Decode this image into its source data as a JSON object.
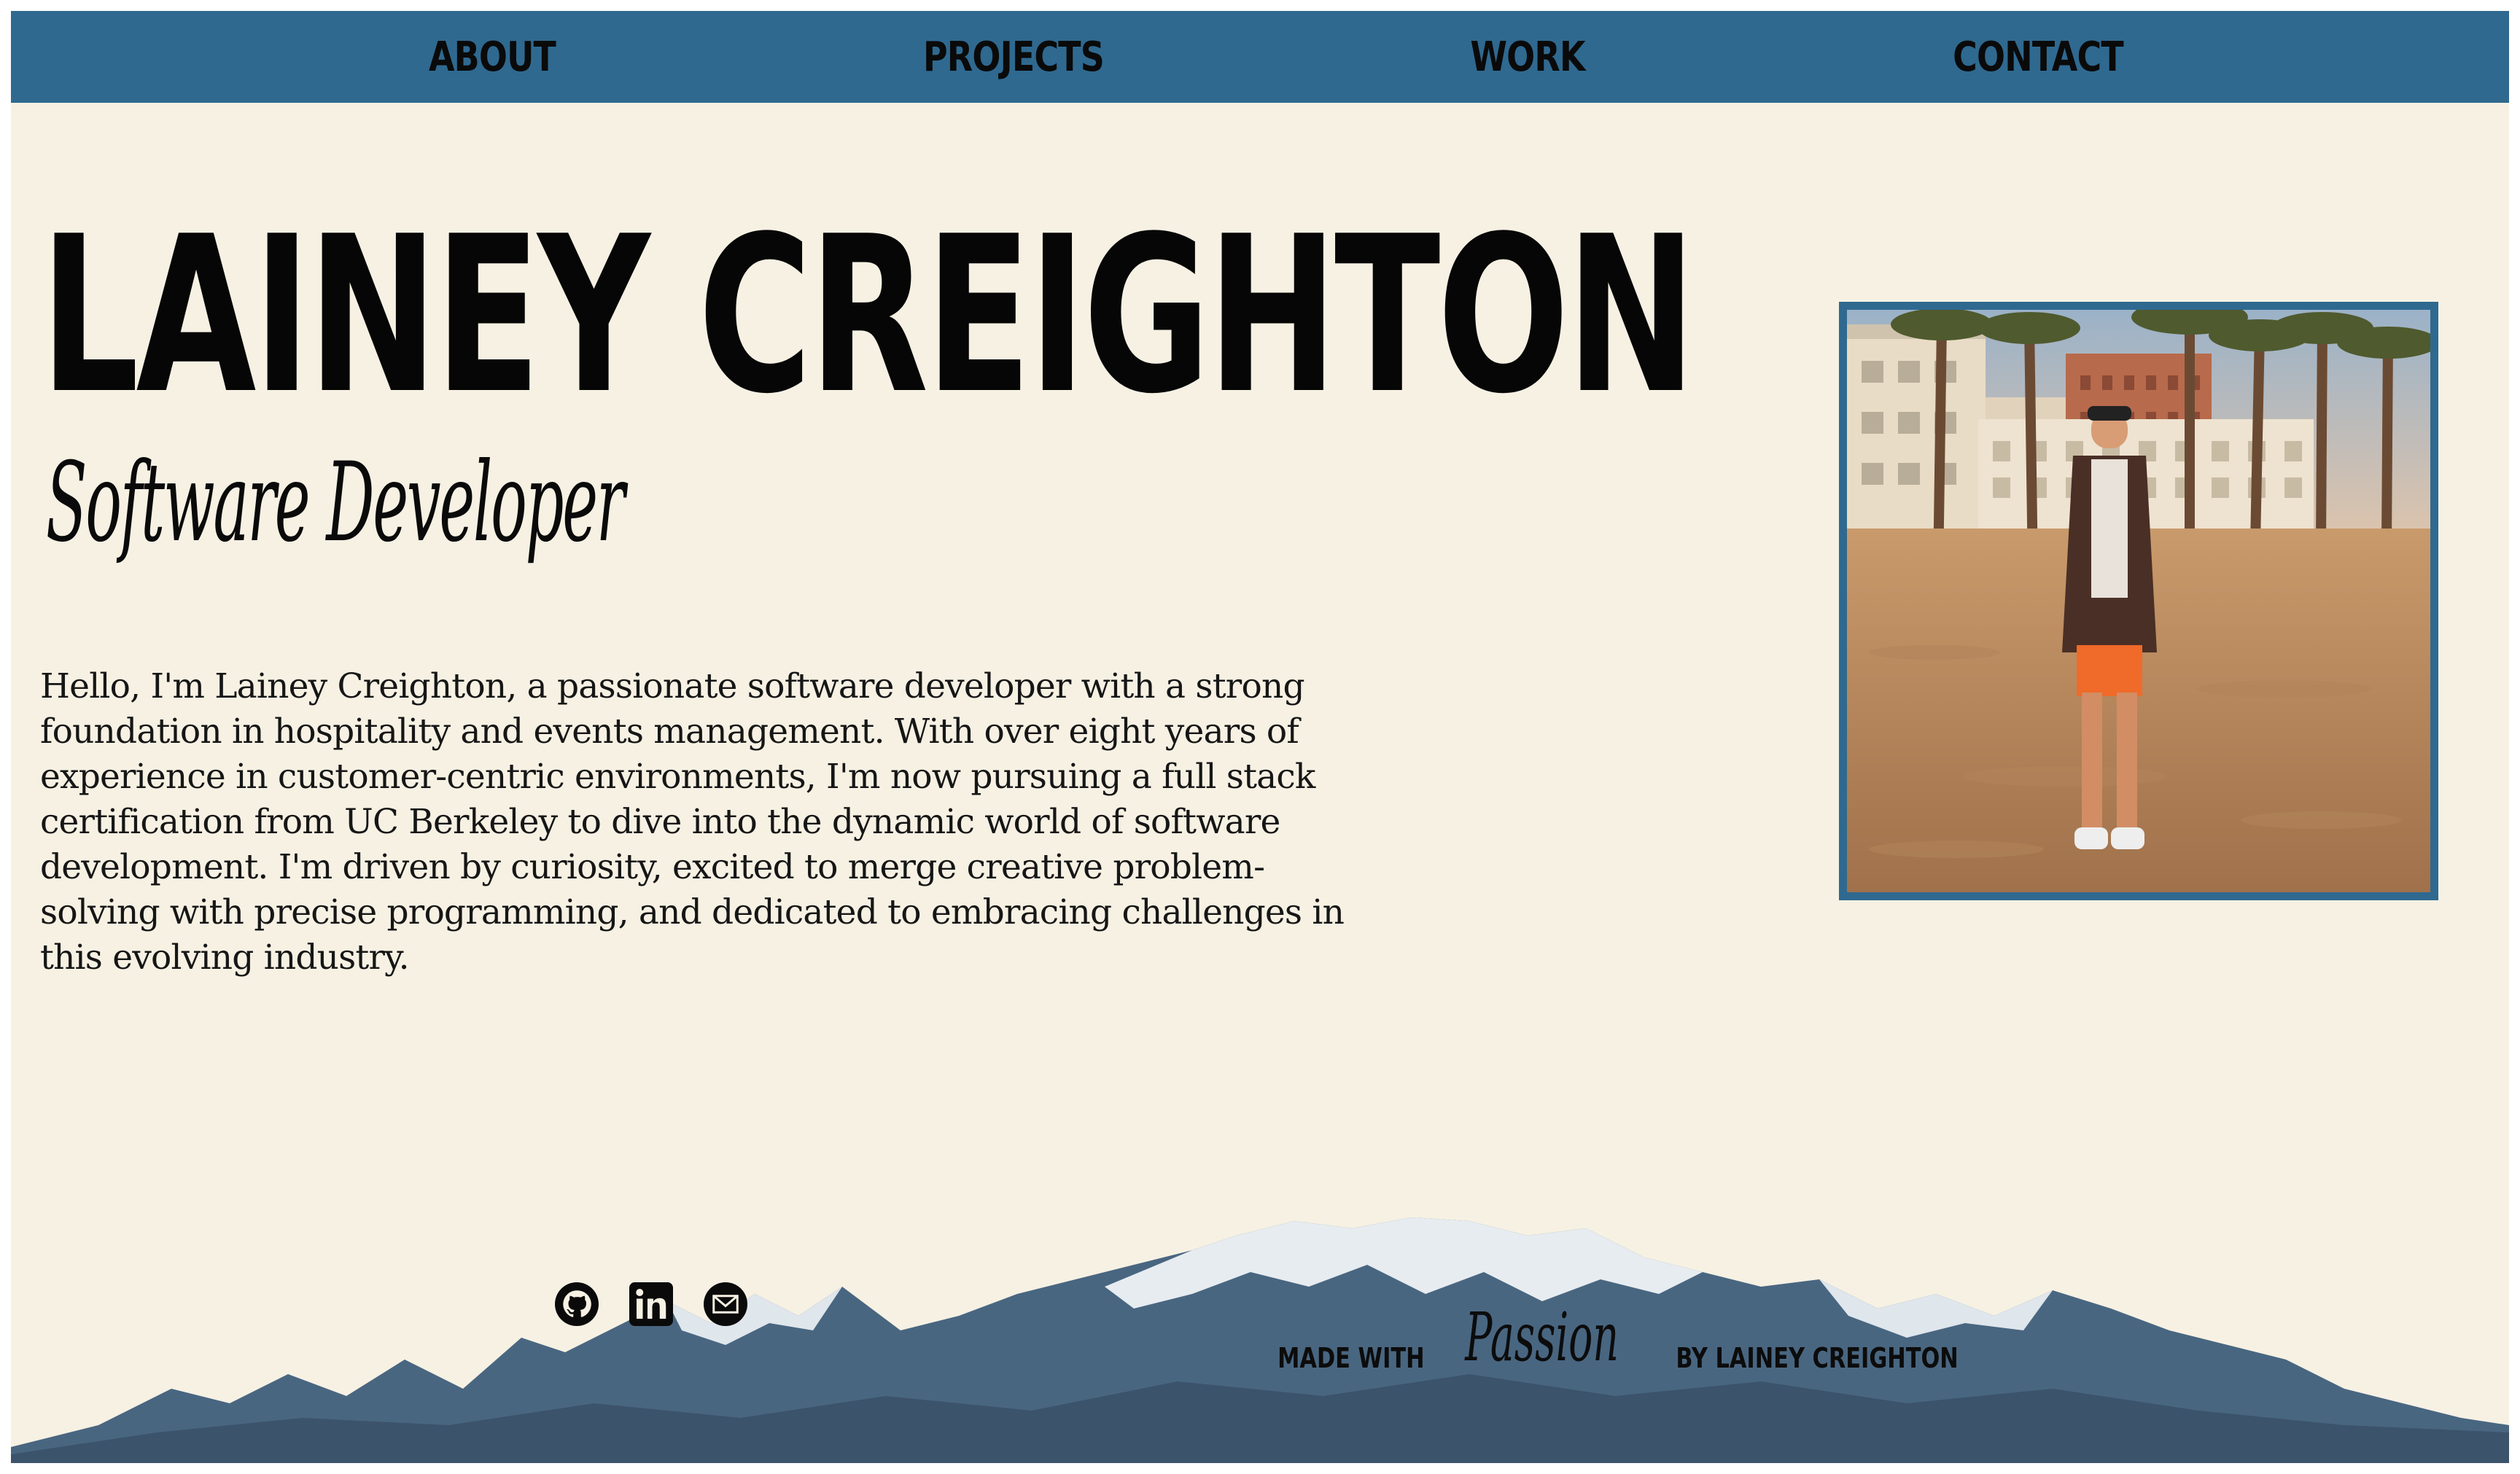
{
  "nav": {
    "items": [
      {
        "label": "ABOUT"
      },
      {
        "label": "PROJECTS"
      },
      {
        "label": "WORK"
      },
      {
        "label": "CONTACT"
      }
    ]
  },
  "hero": {
    "name": "LAINEY CREIGHTON",
    "role": "Software Developer",
    "bio": "Hello, I'm Lainey Creighton, a passionate software developer with a strong foundation in hospitality and events management. With over eight years of experience in customer-centric environments, I'm now pursuing a full stack certification from UC Berkeley to dive into the dynamic world of software development. I'm driven by curiosity, excited to merge creative problem-solving with precise programming, and dedicated to embracing challenges in this evolving industry."
  },
  "footer": {
    "socials": [
      {
        "icon": "github-icon"
      },
      {
        "icon": "linkedin-icon"
      },
      {
        "icon": "email-icon"
      }
    ],
    "credit": {
      "prefix": "MADE WITH",
      "script": "Passion",
      "suffix": "BY LAINEY CREIGHTON"
    }
  },
  "colors": {
    "accent": "#2f6990",
    "background": "#f6f1e3",
    "text": "#0a0a0a"
  }
}
